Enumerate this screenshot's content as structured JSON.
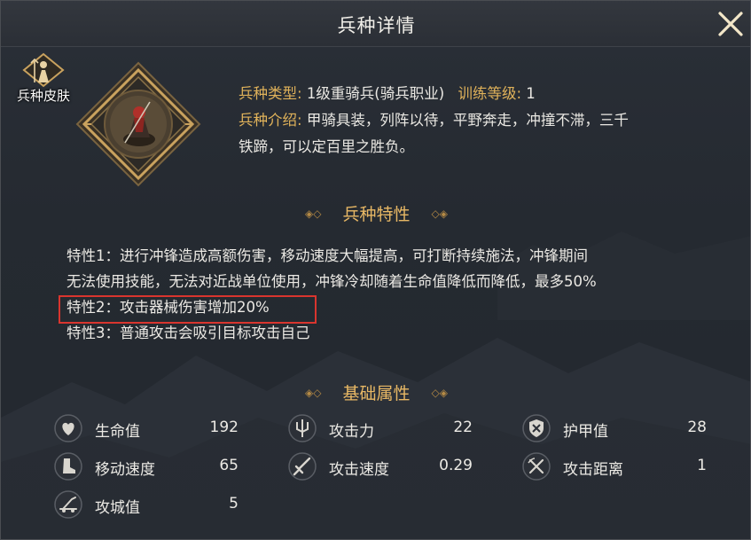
{
  "window": {
    "title": "兵种详情"
  },
  "skin": {
    "label": "兵种皮肤"
  },
  "unit": {
    "type_label": "兵种类型:",
    "type_value": "1级重骑兵(骑兵职业)",
    "level_label": "训练等级:",
    "level_value": "1",
    "intro_label": "兵种介绍:",
    "intro_line1": "甲骑具装，列阵以待，平野奔走，冲撞不滞，三千",
    "intro_line2": "铁蹄，可以定百里之胜负。"
  },
  "traits_section": {
    "title": "兵种特性",
    "lines": [
      "特性1：进行冲锋造成高额伤害，移动速度大幅提高，可打断持续施法，冲锋期间",
      "无法使用技能，无法对近战单位使用，冲锋冷却随着生命值降低而降低，最多50%",
      "特性2：攻击器械伤害增加20%",
      "特性3：普通攻击会吸引目标攻击自己"
    ]
  },
  "stats_section": {
    "title": "基础属性",
    "stats": [
      {
        "name": "生命值",
        "value": "192",
        "icon": "heart-icon"
      },
      {
        "name": "攻击力",
        "value": "22",
        "icon": "trident-icon"
      },
      {
        "name": "护甲值",
        "value": "28",
        "icon": "shield-icon"
      },
      {
        "name": "移动速度",
        "value": "65",
        "icon": "boot-icon"
      },
      {
        "name": "攻击速度",
        "value": "0.29",
        "icon": "sword-icon"
      },
      {
        "name": "攻击距离",
        "value": "1",
        "icon": "bow-icon"
      },
      {
        "name": "攻城值",
        "value": "5",
        "icon": "catapult-icon"
      }
    ]
  },
  "colors": {
    "accent_gold": "#e0b25a",
    "highlight_red": "#d9352e",
    "panel_bg": "#252a31"
  }
}
